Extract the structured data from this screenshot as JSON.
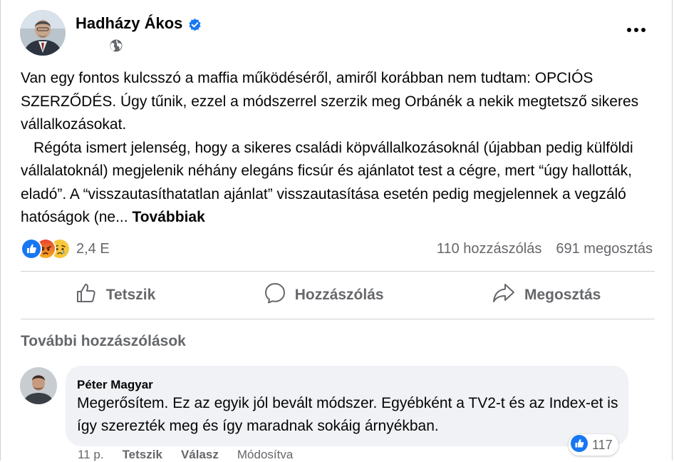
{
  "post": {
    "author": "Hadházy Ákos",
    "verified_icon": "verified-badge-icon",
    "privacy_icon": "globe-icon",
    "paragraph1": "Van egy fontos kulcsszó a maffia működéséről, amiről korábban nem tudtam: OPCIÓS SZERZŐDÉS. Úgy tűnik, ezzel a módszerrel szerzik meg Orbánék a nekik megtetsző sikeres vállalkozásokat.",
    "paragraph2": "Régóta ismert jelenség, hogy a sikeres családi köpvállalkozásoknál (újabban pedig külföldi vállalatoknál) megjelenik néhány elegáns ficsúr és ajánlatot test a cégre, mert “úgy hallották, eladó”. A “visszautasíthatatlan ajánlat” visszautasítása esetén pedig megjelennek a vegzáló hatóságok (ne...",
    "see_more": "Továbbiak"
  },
  "reactions": {
    "icons": [
      "like-reaction-icon",
      "angry-reaction-icon",
      "sad-reaction-icon"
    ],
    "count": "2,4 E",
    "comments": "110 hozzászólás",
    "shares": "691 megosztás"
  },
  "actions": {
    "like": "Tetszik",
    "comment": "Hozzászólás",
    "share": "Megosztás"
  },
  "comments_section": {
    "more_comments": "További hozzászólások",
    "comment": {
      "author": "Péter Magyar",
      "text": "Megerősítem. Ez az egyik jól bevált módszer. Egyébként a TV2-t és az Index-et is így szerezték meg és így maradnak sokáig árnyékban.",
      "likes": "117",
      "time": "11 p.",
      "like_label": "Tetszik",
      "reply_label": "Válasz",
      "edited_label": "Módosítva"
    }
  },
  "colors": {
    "accent": "#1877f2",
    "secondary_text": "#65676b",
    "bubble": "#f0f2f5"
  }
}
